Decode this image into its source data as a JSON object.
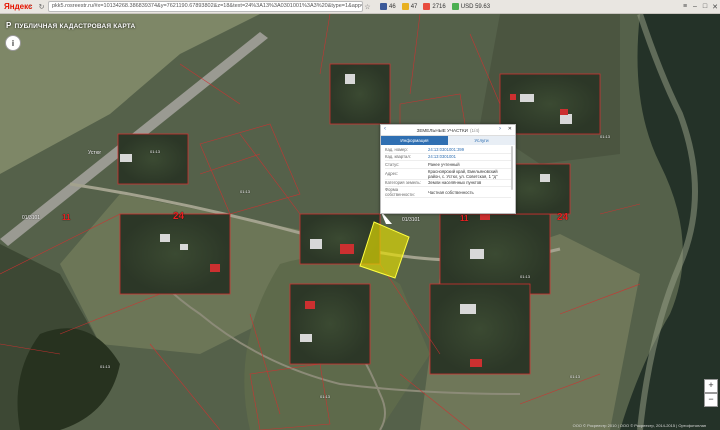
{
  "browser": {
    "brand": "Яндекс",
    "url": "pkk5.rosreestr.ru/#x=10134268.386839374&y=7621190.67893802&z=18&text=24%3A13%3A0301001%3A3%20&type=1&app=search&opened=1",
    "bookmarks": [
      {
        "label": "46",
        "color": "#3b5998"
      },
      {
        "label": "47",
        "color": "#e8b020"
      },
      {
        "label": "2716",
        "color": "#e84c3d"
      },
      {
        "label": "USD 59.63",
        "color": "#4caf50"
      }
    ]
  },
  "app": {
    "logo": "Р",
    "title": "ПУБЛИЧНАЯ КАДАСТРОВАЯ КАРТА",
    "info_icon": "i"
  },
  "popup": {
    "title": "ЗЕМЕЛЬНЫЕ УЧАСТКИ",
    "count": "(1/4)",
    "tabs": [
      "Информация",
      "Услуги"
    ],
    "rows": [
      {
        "k": "Кад. номер:",
        "v": "24:13:0301001:399",
        "link": true
      },
      {
        "k": "Кад. квартал:",
        "v": "24:13:0301001",
        "link": true
      },
      {
        "k": "Статус:",
        "v": "Ранее учтенный",
        "link": false
      },
      {
        "k": "Адрес:",
        "v": "Красноярский край, Емельяновский район, с. Устюг, ул. Советская, 1 \"д\"",
        "link": false
      },
      {
        "k": "Категория земель:",
        "v": "Земли населённых пунктов",
        "link": false
      },
      {
        "k": "Форма собственности:",
        "v": "Частная собственность",
        "link": false
      }
    ]
  },
  "map": {
    "zoom_in": "+",
    "zoom_out": "−",
    "attribution": "ООО © Росреестр 2010 | ООО © Росреестр, 2014-2015 | Ортофотоплан",
    "big_labels": [
      "24",
      "24",
      "11",
      "11"
    ],
    "street_labels": [
      "Устюг",
      "01/3101"
    ],
    "cad_labels": [
      "01:13",
      "01:13",
      "01:13",
      "01:13",
      "01:13",
      "01:13",
      "01:13"
    ]
  }
}
